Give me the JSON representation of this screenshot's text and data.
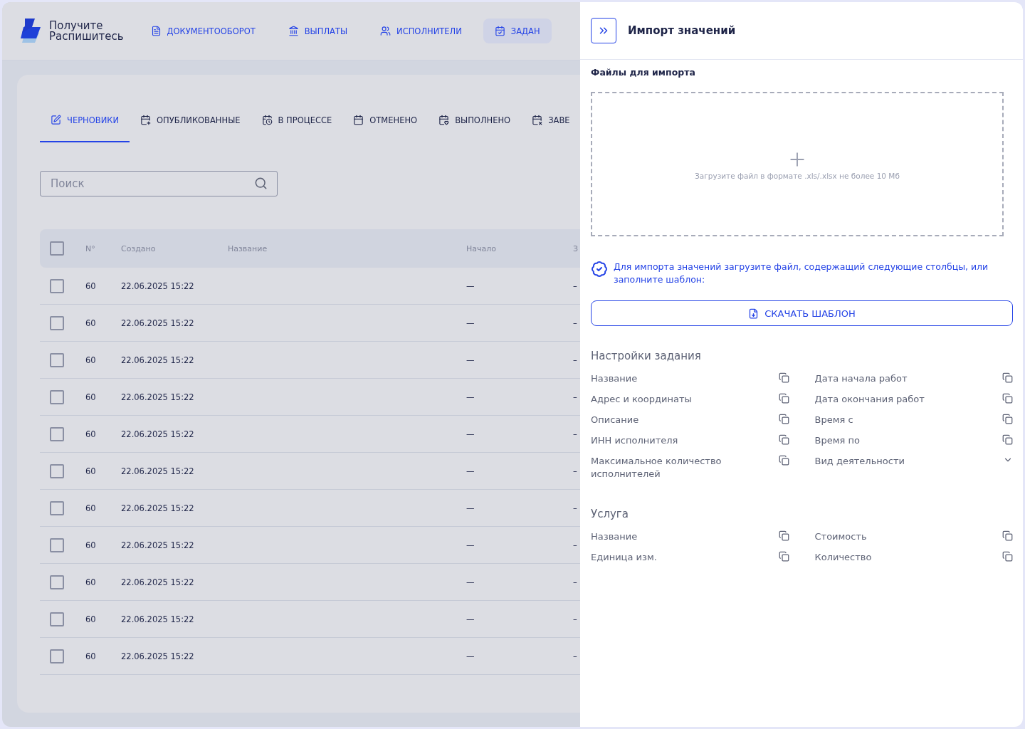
{
  "header": {
    "logo_lines": [
      "Получите",
      "Распишитесь"
    ],
    "nav": [
      {
        "label": "ДОКУМЕНТООБОРОТ",
        "selected": false
      },
      {
        "label": "ВЫПЛАТЫ",
        "selected": false
      },
      {
        "label": "ИСПОЛНИТЕЛИ",
        "selected": false
      },
      {
        "label": "ЗАДАН",
        "selected": true
      }
    ]
  },
  "tabs": [
    {
      "label": "ЧЕРНОВИКИ",
      "selected": true
    },
    {
      "label": "ОПУБЛИКОВАННЫЕ",
      "selected": false
    },
    {
      "label": "В ПРОЦЕССЕ",
      "selected": false
    },
    {
      "label": "ОТМЕНЕНО",
      "selected": false
    },
    {
      "label": "ВЫПОЛНЕНО",
      "selected": false
    },
    {
      "label": "ЗАВЕ",
      "selected": false
    }
  ],
  "search": {
    "placeholder": "Поиск"
  },
  "table": {
    "select_all_checked": false,
    "columns": [
      "N°",
      "Создано",
      "Название",
      "Начало",
      "З"
    ],
    "rows": [
      {
        "checked": false,
        "number": "60",
        "created": "22.06.2025 15:22",
        "start": "—",
        "column_5": "–"
      },
      {
        "checked": false,
        "number": "60",
        "created": "22.06.2025 15:22",
        "start": "—",
        "column_5": "–"
      },
      {
        "checked": false,
        "number": "60",
        "created": "22.06.2025 15:22",
        "start": "—",
        "column_5": "–"
      },
      {
        "checked": false,
        "number": "60",
        "created": "22.06.2025 15:22",
        "start": "—",
        "column_5": "–"
      },
      {
        "checked": false,
        "number": "60",
        "created": "22.06.2025 15:22",
        "start": "—",
        "column_5": "–"
      },
      {
        "checked": false,
        "number": "60",
        "created": "22.06.2025 15:22",
        "start": "—",
        "column_5": "–"
      },
      {
        "checked": false,
        "number": "60",
        "created": "22.06.2025 15:22",
        "start": "—",
        "column_5": "–"
      },
      {
        "checked": false,
        "number": "60",
        "created": "22.06.2025 15:22",
        "start": "—",
        "column_5": "–"
      },
      {
        "checked": false,
        "number": "60",
        "created": "22.06.2025 15:22",
        "start": "—",
        "column_5": "–"
      },
      {
        "checked": false,
        "number": "60",
        "created": "22.06.2025 15:22",
        "start": "—",
        "column_5": "–"
      },
      {
        "checked": false,
        "number": "60",
        "created": "22.06.2025 15:22",
        "start": "—",
        "column_5": "–"
      }
    ]
  },
  "drawer": {
    "title": "Импорт значений",
    "files_label": "Файлы для импорта",
    "dropzone_hint": "Загрузите файл в формате .xls/.xlsx не более 10 Мб",
    "info": "Для импорта значений загрузите файл, содержащий следующие столбцы, или заполните шаблон:",
    "download_button": "СКАЧАТЬ ШАБЛОН",
    "sections": [
      {
        "title": "Настройки задания",
        "fields": [
          {
            "label": "Название",
            "kind": "copy"
          },
          {
            "label": "Дата начала работ",
            "kind": "copy"
          },
          {
            "label": "Адрес и координаты",
            "kind": "copy"
          },
          {
            "label": "Дата окончания работ",
            "kind": "copy"
          },
          {
            "label": "Описание",
            "kind": "copy"
          },
          {
            "label": "Время с",
            "kind": "copy"
          },
          {
            "label": "ИНН исполнителя",
            "kind": "copy"
          },
          {
            "label": "Время по",
            "kind": "copy"
          },
          {
            "label": "Максимальное количество исполнителей",
            "kind": "copy"
          },
          {
            "label": "Вид деятельности",
            "kind": "select"
          }
        ]
      },
      {
        "title": "Услуга",
        "fields": [
          {
            "label": "Название",
            "kind": "copy"
          },
          {
            "label": "Стоимость",
            "kind": "copy"
          },
          {
            "label": "Единица изм.",
            "kind": "copy"
          },
          {
            "label": "Количество",
            "kind": "copy"
          }
        ]
      }
    ]
  }
}
